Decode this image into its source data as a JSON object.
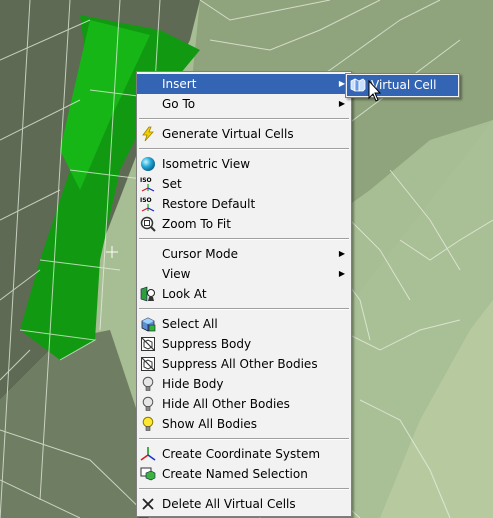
{
  "colors": {
    "mesh_dark": "#5b6650",
    "mesh_light": "#a7bd93",
    "selection_green": "#119a11",
    "menu_bg": "#f2f2f2",
    "highlight": "#3465b4"
  },
  "context_menu": {
    "insert": "Insert",
    "go_to": "Go To",
    "generate_virtual_cells": "Generate Virtual Cells",
    "isometric_view": "Isometric View",
    "set": "Set",
    "restore_default": "Restore Default",
    "zoom_to_fit": "Zoom To Fit",
    "cursor_mode": "Cursor Mode",
    "view": "View",
    "look_at": "Look At",
    "select_all": "Select All",
    "suppress_body": "Suppress Body",
    "suppress_all_other_bodies": "Suppress All Other Bodies",
    "hide_body": "Hide Body",
    "hide_all_other_bodies": "Hide All Other Bodies",
    "show_all_bodies": "Show All Bodies",
    "create_coordinate_system": "Create Coordinate System",
    "create_named_selection": "Create Named Selection",
    "delete_all_virtual_cells": "Delete All Virtual Cells"
  },
  "submenu": {
    "virtual_cell": "Virtual Cell"
  },
  "icons": {
    "generate": "lightning-icon",
    "isometric": "sphere-icon",
    "set": "iso-set-icon",
    "restore": "iso-restore-icon",
    "zoom": "zoom-fit-icon",
    "look_at": "look-at-icon",
    "select_all": "select-all-icon",
    "suppress": "suppress-body-icon",
    "hide": "lightbulb-off-icon",
    "show": "lightbulb-on-icon",
    "coord": "coordinate-system-icon",
    "named_sel": "named-selection-icon",
    "delete": "delete-x-icon",
    "virtual_cell": "virtual-cell-icon",
    "cursor": "mouse-pointer-icon"
  }
}
